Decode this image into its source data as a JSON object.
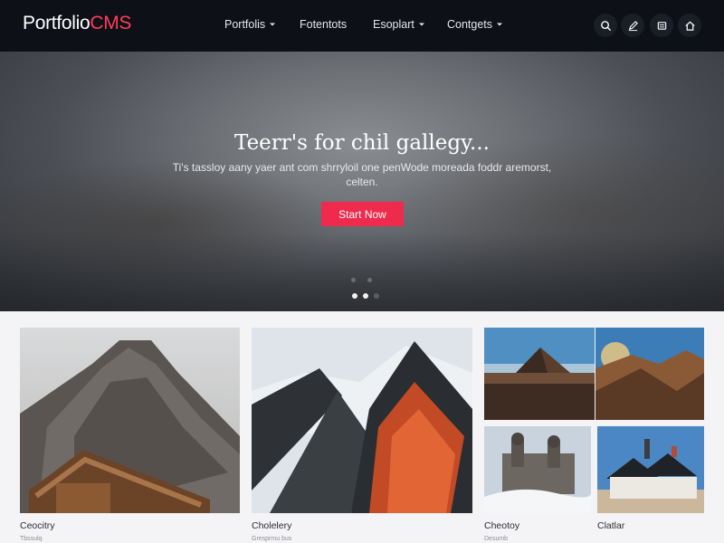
{
  "brand": {
    "name_part1": "Portfolio",
    "name_part2": "CMS",
    "accent": "#ff3b5c"
  },
  "nav": {
    "items": [
      {
        "label": "Portfolis",
        "has_dropdown": true
      },
      {
        "label": "Fotentots",
        "has_dropdown": false
      },
      {
        "label": "Esoplart",
        "has_dropdown": true
      },
      {
        "label": "Contgets",
        "has_dropdown": true
      }
    ],
    "icons": [
      "search-icon",
      "edit-icon",
      "layers-icon",
      "home-icon"
    ]
  },
  "hero": {
    "title": "Teerr's for chil gallegy...",
    "subtitle": "Ti's tassloy aany yaer ant com shrryloil one penWode moreada foddr aremorst, celten.",
    "cta_label": "Start Now",
    "cta_color": "#ee2b4d",
    "slides_total": 3,
    "slide_active": 1
  },
  "gallery": {
    "items": [
      {
        "caption": "Ceocitry",
        "sub": "Tbssulq"
      },
      {
        "caption": "Cholelery",
        "sub": "Gresprmu bus"
      },
      {
        "caption": "Cheotoy",
        "sub": "Desumb"
      },
      {
        "caption": "Clatlar",
        "sub": ""
      }
    ]
  }
}
